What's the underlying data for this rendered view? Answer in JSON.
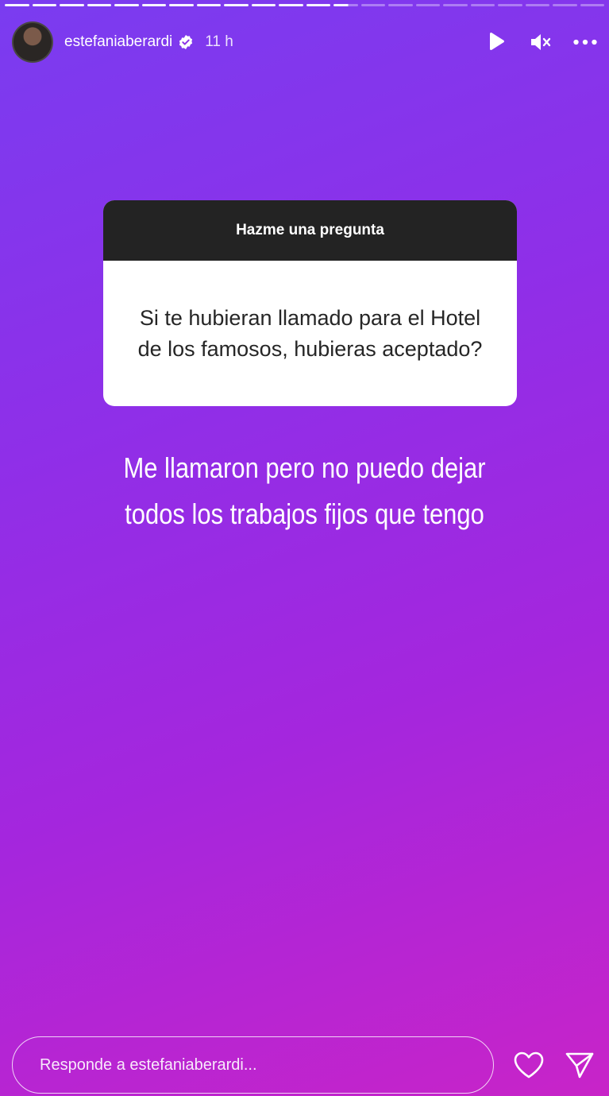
{
  "story": {
    "segments_total": 22,
    "segments_done": 12,
    "active_segment_fraction": 0.6
  },
  "header": {
    "username": "estefaniaberardi",
    "verified": true,
    "time": "11 h",
    "icons": [
      "play-icon",
      "mute-icon",
      "more-icon"
    ]
  },
  "question": {
    "title": "Hazme una pregunta",
    "text": "Si te hubieran llamado para el Hotel de los famosos, hubieras aceptado?"
  },
  "answer": {
    "line1": "Me llamaron pero no puedo dejar",
    "line2": "todos los trabajos fijos que tengo"
  },
  "footer": {
    "reply_placeholder": "Responde a estefaniaberardi...",
    "icons": [
      "heart-icon",
      "send-icon"
    ]
  },
  "colors": {
    "gradient_start": "#7a3cf0",
    "gradient_end": "#c824c8",
    "question_header": "#232323",
    "question_body": "#ffffff"
  }
}
